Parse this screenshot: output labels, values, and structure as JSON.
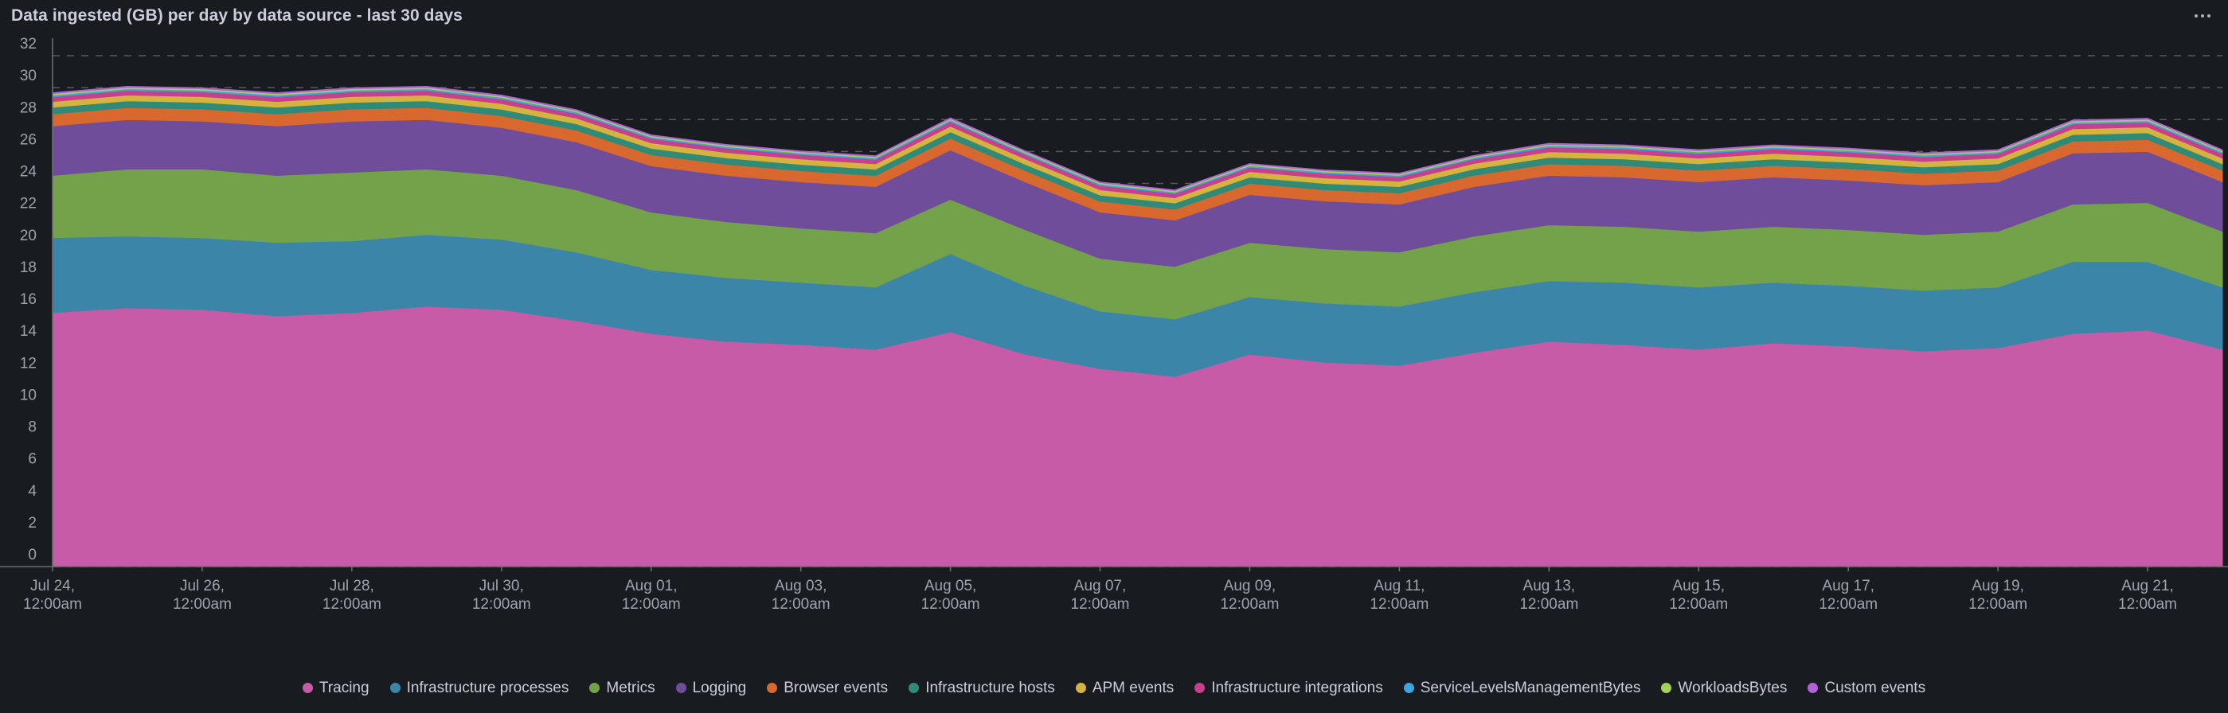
{
  "panel": {
    "title": "Data ingested (GB) per day by data source - last 30 days",
    "menu_icon": "kebab-menu-icon",
    "background_color": "#181b1f"
  },
  "chart_data": {
    "type": "area",
    "stacked": true,
    "title": "Data ingested (GB) per day by data source - last 30 days",
    "xlabel": "",
    "ylabel": "",
    "ylim": [
      0,
      32
    ],
    "ytick_values": [
      0,
      2,
      4,
      6,
      8,
      10,
      12,
      14,
      16,
      18,
      20,
      22,
      24,
      26,
      28,
      30,
      32
    ],
    "ytick_labels": [
      "0",
      "2",
      "4",
      "6",
      "8",
      "10",
      "12",
      "14",
      "16",
      "18",
      "20",
      "22",
      "24",
      "26",
      "28",
      "30",
      "32"
    ],
    "grid": true,
    "legend_position": "bottom",
    "x_tick_labels": [
      "Jul 24,\n12:00am",
      "Jul 26,\n12:00am",
      "Jul 28,\n12:00am",
      "Jul 30,\n12:00am",
      "Aug 01,\n12:00am",
      "Aug 03,\n12:00am",
      "Aug 05,\n12:00am",
      "Aug 07,\n12:00am",
      "Aug 09,\n12:00am",
      "Aug 11,\n12:00am",
      "Aug 13,\n12:00am",
      "Aug 15,\n12:00am",
      "Aug 17,\n12:00am",
      "Aug 19,\n12:00am",
      "Aug 21,\n12:00am"
    ],
    "x": [
      "Jul 24",
      "Jul 25",
      "Jul 26",
      "Jul 27",
      "Jul 28",
      "Jul 29",
      "Jul 30",
      "Jul 31",
      "Aug 01",
      "Aug 02",
      "Aug 03",
      "Aug 04",
      "Aug 05",
      "Aug 06",
      "Aug 07",
      "Aug 08",
      "Aug 09",
      "Aug 10",
      "Aug 11",
      "Aug 12",
      "Aug 13",
      "Aug 14",
      "Aug 15",
      "Aug 16",
      "Aug 17",
      "Aug 18",
      "Aug 19",
      "Aug 20",
      "Aug 21",
      "Aug 22"
    ],
    "series": [
      {
        "name": "Tracing",
        "color": "#c85ba8",
        "values": [
          15.9,
          16.2,
          16.1,
          15.7,
          15.9,
          16.3,
          16.1,
          15.4,
          14.6,
          14.1,
          13.9,
          13.6,
          14.7,
          13.3,
          12.4,
          11.9,
          13.3,
          12.8,
          12.6,
          13.4,
          14.1,
          13.9,
          13.6,
          14.0,
          13.8,
          13.5,
          13.7,
          14.6,
          14.8,
          13.6
        ]
      },
      {
        "name": "Infrastructure processes",
        "color": "#3b86a8",
        "values": [
          4.7,
          4.5,
          4.5,
          4.6,
          4.5,
          4.5,
          4.4,
          4.3,
          4.0,
          4.0,
          3.9,
          3.9,
          4.9,
          4.3,
          3.6,
          3.6,
          3.6,
          3.7,
          3.7,
          3.8,
          3.8,
          3.9,
          3.9,
          3.8,
          3.8,
          3.8,
          3.8,
          4.5,
          4.3,
          3.9
        ]
      },
      {
        "name": "Metrics",
        "color": "#74a24a",
        "values": [
          3.9,
          4.2,
          4.3,
          4.2,
          4.3,
          4.1,
          4.0,
          3.9,
          3.6,
          3.5,
          3.4,
          3.4,
          3.4,
          3.5,
          3.3,
          3.3,
          3.4,
          3.4,
          3.4,
          3.5,
          3.5,
          3.5,
          3.5,
          3.5,
          3.5,
          3.5,
          3.5,
          3.6,
          3.7,
          3.5
        ]
      },
      {
        "name": "Logging",
        "color": "#6f4d9b",
        "values": [
          3.1,
          3.1,
          3.0,
          3.1,
          3.2,
          3.1,
          3.0,
          3.0,
          2.9,
          2.9,
          2.9,
          2.9,
          3.1,
          3.0,
          2.9,
          2.9,
          3.0,
          3.0,
          3.0,
          3.1,
          3.1,
          3.1,
          3.1,
          3.1,
          3.1,
          3.1,
          3.1,
          3.2,
          3.2,
          3.1
        ]
      },
      {
        "name": "Browser events",
        "color": "#d9682f",
        "values": [
          0.75,
          0.75,
          0.76,
          0.75,
          0.76,
          0.75,
          0.74,
          0.73,
          0.7,
          0.7,
          0.69,
          0.69,
          0.72,
          0.7,
          0.68,
          0.68,
          0.7,
          0.7,
          0.7,
          0.71,
          0.72,
          0.72,
          0.72,
          0.72,
          0.72,
          0.72,
          0.72,
          0.74,
          0.75,
          0.72
        ]
      },
      {
        "name": "Infrastructure hosts",
        "color": "#2f8a78",
        "values": [
          0.42,
          0.42,
          0.42,
          0.42,
          0.42,
          0.42,
          0.41,
          0.41,
          0.4,
          0.4,
          0.4,
          0.4,
          0.41,
          0.4,
          0.39,
          0.39,
          0.4,
          0.4,
          0.4,
          0.4,
          0.41,
          0.41,
          0.41,
          0.41,
          0.41,
          0.41,
          0.41,
          0.42,
          0.42,
          0.41
        ]
      },
      {
        "name": "APM events",
        "color": "#d6b33c",
        "values": [
          0.36,
          0.36,
          0.36,
          0.36,
          0.36,
          0.36,
          0.35,
          0.35,
          0.34,
          0.34,
          0.34,
          0.34,
          0.35,
          0.34,
          0.33,
          0.33,
          0.34,
          0.34,
          0.34,
          0.34,
          0.35,
          0.35,
          0.35,
          0.35,
          0.35,
          0.35,
          0.35,
          0.36,
          0.36,
          0.35
        ]
      },
      {
        "name": "Infrastructure integrations",
        "color": "#c6408b",
        "values": [
          0.3,
          0.3,
          0.3,
          0.3,
          0.3,
          0.3,
          0.29,
          0.29,
          0.28,
          0.28,
          0.28,
          0.28,
          0.29,
          0.28,
          0.27,
          0.27,
          0.28,
          0.28,
          0.28,
          0.28,
          0.29,
          0.29,
          0.29,
          0.29,
          0.29,
          0.29,
          0.29,
          0.3,
          0.3,
          0.29
        ]
      },
      {
        "name": "ServiceLevelsManagementBytes",
        "color": "#3ca6dd",
        "values": [
          0.1,
          0.1,
          0.1,
          0.1,
          0.1,
          0.1,
          0.1,
          0.1,
          0.09,
          0.09,
          0.09,
          0.09,
          0.1,
          0.09,
          0.09,
          0.09,
          0.09,
          0.09,
          0.09,
          0.09,
          0.1,
          0.1,
          0.1,
          0.1,
          0.1,
          0.1,
          0.1,
          0.1,
          0.1,
          0.1
        ]
      },
      {
        "name": "WorkloadsBytes",
        "color": "#a3d15c",
        "values": [
          0.09,
          0.09,
          0.09,
          0.09,
          0.09,
          0.09,
          0.08,
          0.08,
          0.08,
          0.08,
          0.08,
          0.08,
          0.08,
          0.08,
          0.08,
          0.08,
          0.08,
          0.08,
          0.08,
          0.08,
          0.08,
          0.08,
          0.08,
          0.08,
          0.08,
          0.08,
          0.08,
          0.09,
          0.09,
          0.08
        ]
      },
      {
        "name": "Custom events",
        "color": "#b362d6",
        "values": [
          0.06,
          0.06,
          0.06,
          0.06,
          0.06,
          0.06,
          0.06,
          0.06,
          0.05,
          0.05,
          0.05,
          0.05,
          0.06,
          0.05,
          0.05,
          0.05,
          0.05,
          0.05,
          0.05,
          0.05,
          0.06,
          0.06,
          0.06,
          0.06,
          0.06,
          0.06,
          0.06,
          0.06,
          0.06,
          0.06
        ]
      }
    ]
  },
  "legend": {
    "items": [
      {
        "label": "Tracing",
        "color": "#c85ba8"
      },
      {
        "label": "Infrastructure processes",
        "color": "#3b86a8"
      },
      {
        "label": "Metrics",
        "color": "#74a24a"
      },
      {
        "label": "Logging",
        "color": "#6f4d9b"
      },
      {
        "label": "Browser events",
        "color": "#d9682f"
      },
      {
        "label": "Infrastructure hosts",
        "color": "#2f8a78"
      },
      {
        "label": "APM events",
        "color": "#d6b33c"
      },
      {
        "label": "Infrastructure integrations",
        "color": "#c6408b"
      },
      {
        "label": "ServiceLevelsManagementBytes",
        "color": "#3ca6dd"
      },
      {
        "label": "WorkloadsBytes",
        "color": "#a3d15c"
      },
      {
        "label": "Custom events",
        "color": "#b362d6"
      }
    ]
  }
}
